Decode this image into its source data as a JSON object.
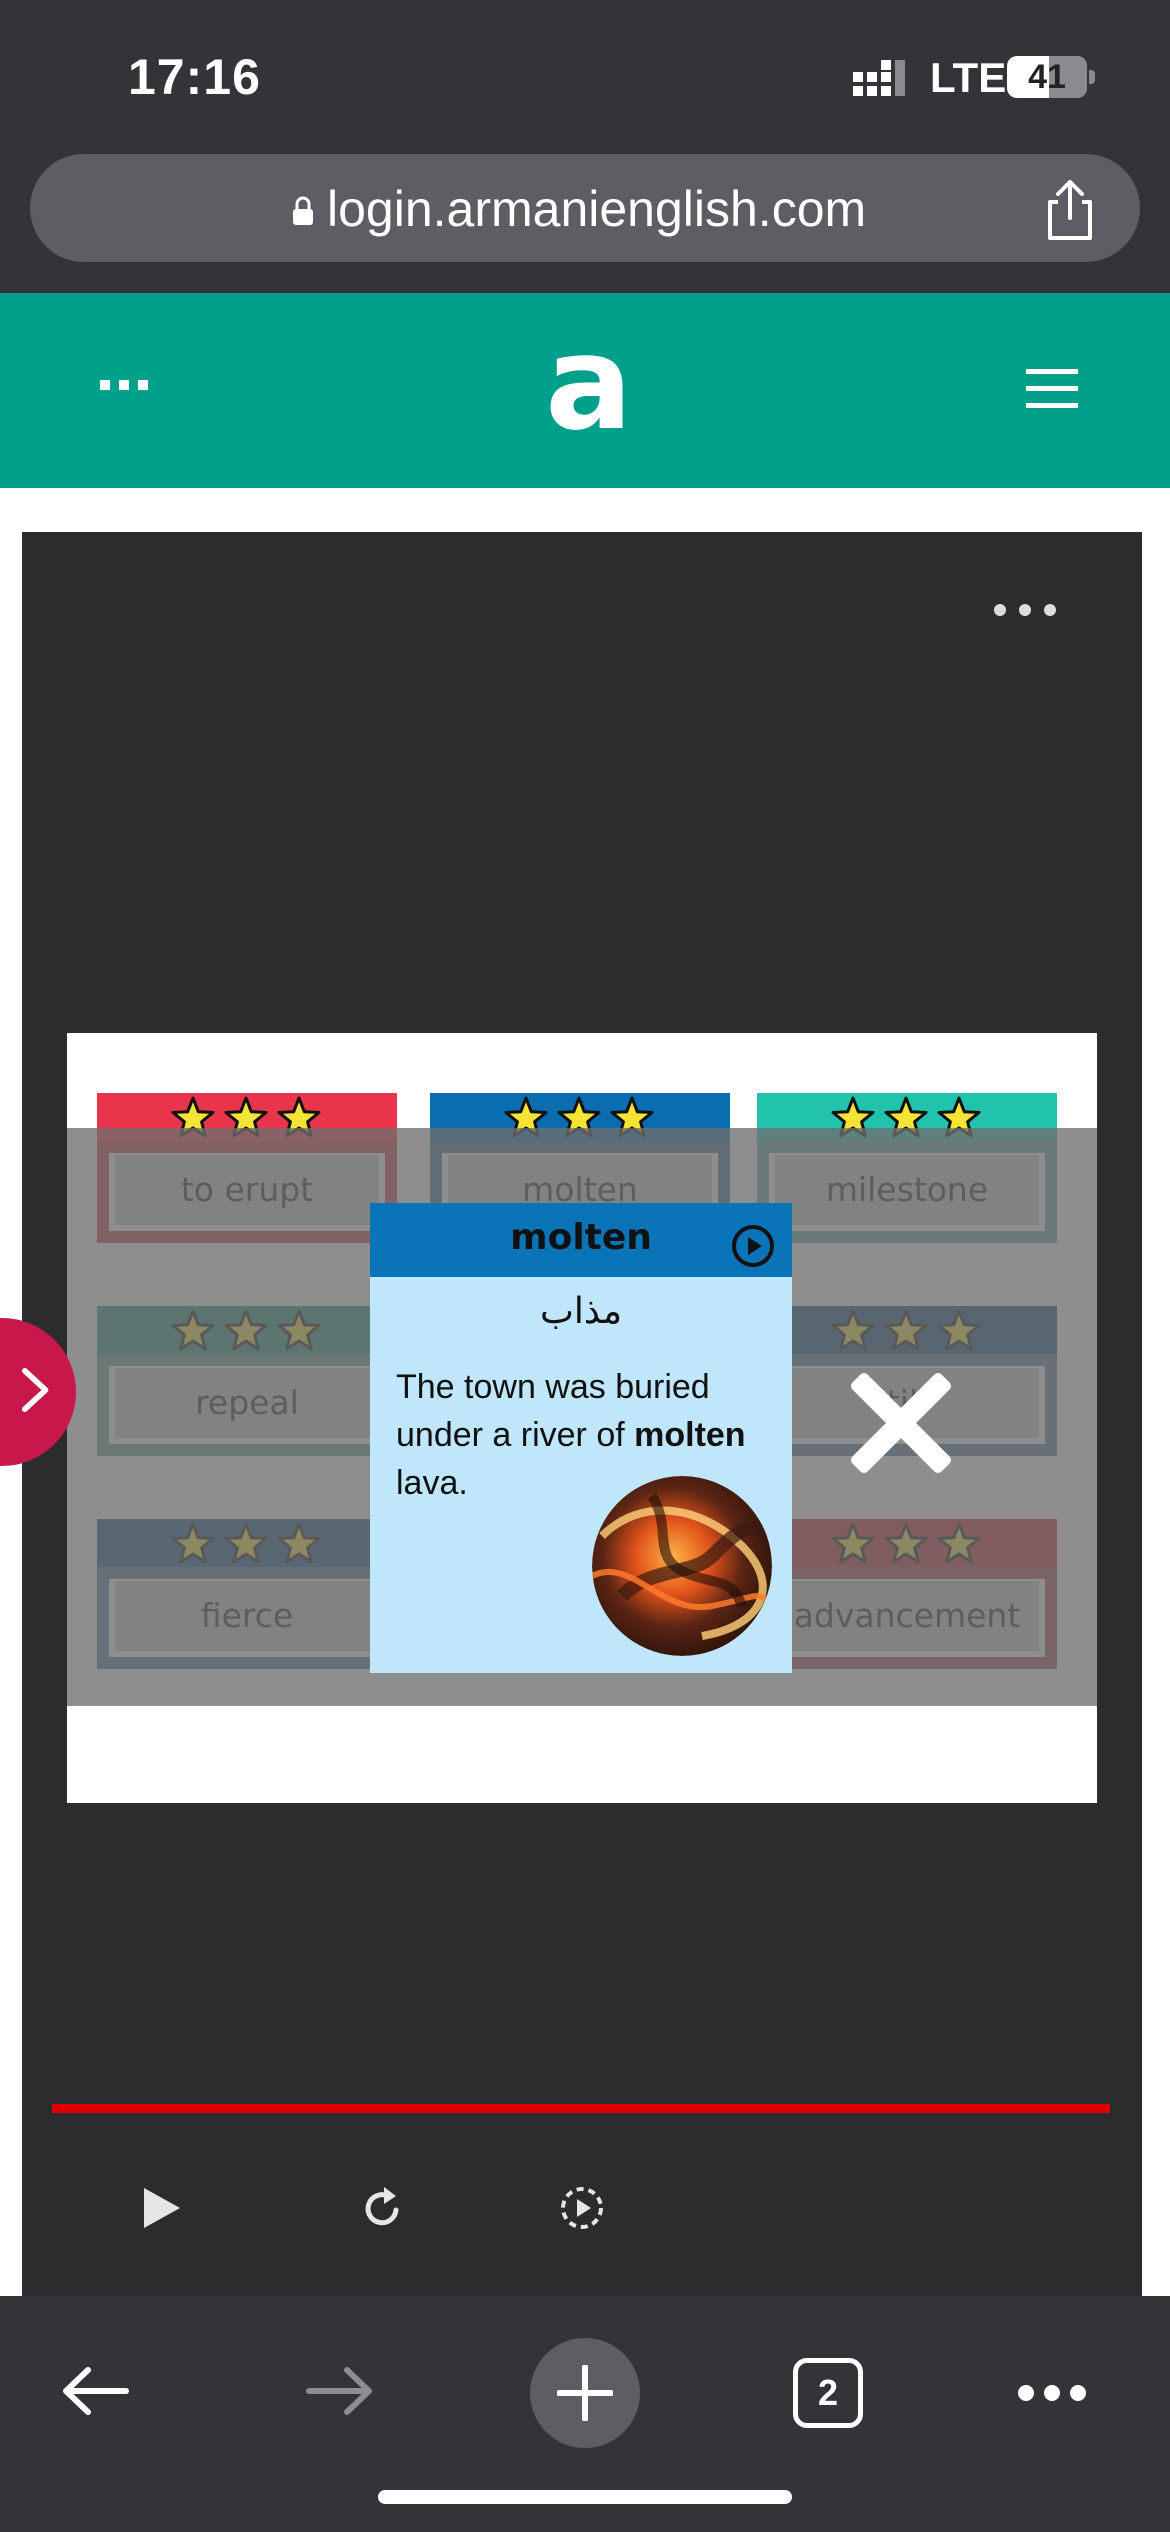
{
  "status_bar": {
    "time": "17:16",
    "network": "LTE",
    "battery": "41"
  },
  "browser": {
    "url": "login.armanienglish.com",
    "tab_count": "2"
  },
  "site": {
    "logo": "a"
  },
  "activity": {
    "cards": [
      {
        "word": "to erupt",
        "bar_color": "#e8354b",
        "frame_color": "#c7323f"
      },
      {
        "word": "molten",
        "bar_color": "#0a6db0",
        "frame_color": "#3a6d97"
      },
      {
        "word": "milestone",
        "bar_color": "#21c3ad",
        "frame_color": "#5aa59b"
      },
      {
        "word": "repeal",
        "bar_color": "#1b8f7a",
        "frame_color": "#5e9a91"
      },
      {
        "word": "till",
        "bar_color": "#0b4a7a",
        "frame_color": "#4f7596"
      },
      {
        "word": "fierce",
        "bar_color": "#0e4e80",
        "frame_color": "#4f7596"
      },
      {
        "word": "advancement",
        "bar_color": "#c2202c",
        "frame_color": "#a0454f"
      }
    ],
    "popup": {
      "word": "molten",
      "translation": "مذاب",
      "sentence_before": "The town was buried under a river of ",
      "sentence_bold": "molten",
      "sentence_after": " lava."
    },
    "progress_percent": 100
  }
}
